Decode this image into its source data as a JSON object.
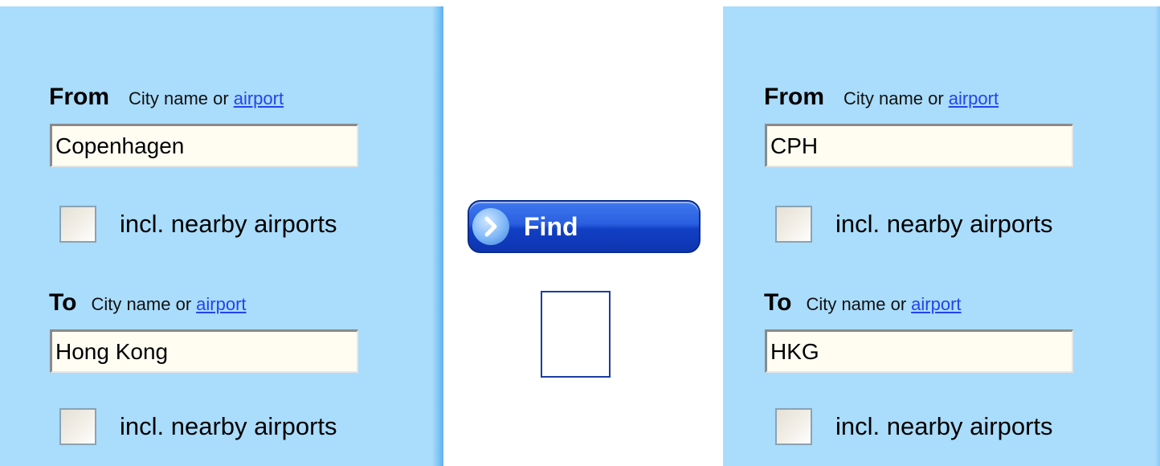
{
  "left_form": {
    "from": {
      "label": "From",
      "hint": "City name or",
      "link": "airport",
      "value": "Copenhagen",
      "nearby_label": "incl. nearby airports"
    },
    "to": {
      "label": "To",
      "hint": "City name or",
      "link": "airport",
      "value": "Hong Kong",
      "nearby_label": "incl. nearby airports"
    }
  },
  "right_form": {
    "from": {
      "label": "From",
      "hint": "City name or",
      "link": "airport",
      "value": "CPH",
      "nearby_label": "incl. nearby airports"
    },
    "to": {
      "label": "To",
      "hint": "City name or",
      "link": "airport",
      "value": "HKG",
      "nearby_label": "incl. nearby airports"
    }
  },
  "find_button": {
    "label": "Find",
    "icon": "chevron-right-icon"
  },
  "colors": {
    "panel_bg": "#aadcfb",
    "button_blue": "#1f4fd0",
    "link_blue": "#2244ee"
  }
}
